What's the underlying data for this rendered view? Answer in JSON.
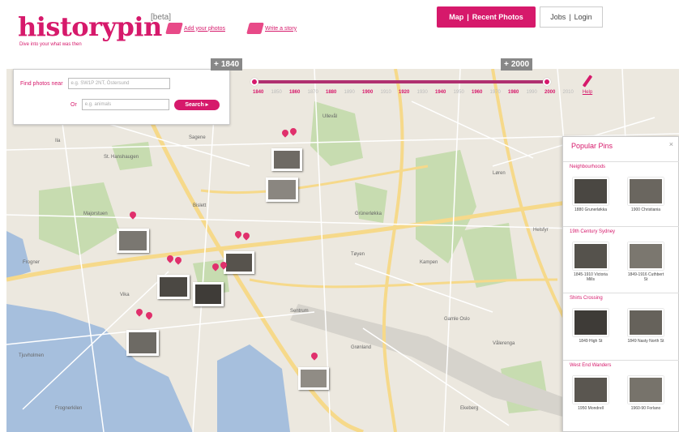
{
  "header": {
    "logo": "historypin",
    "beta": "[beta]",
    "tagline": "Dive into your what was then",
    "links": [
      "Add your photos",
      "Write a story"
    ],
    "nav_pink": [
      "Map",
      "|",
      "Recent Photos"
    ],
    "nav_white": [
      "Jobs",
      "|",
      "Login"
    ]
  },
  "search": {
    "label_find": "Find photos near",
    "placeholder_place": "e.g. SW1P 2NT, Östersund",
    "label_or": "Or",
    "placeholder_keyword": "e.g. animals",
    "button": "Search ▸"
  },
  "timeline": {
    "start_year": "1840",
    "end_year": "2000",
    "years": [
      "1840",
      "1850",
      "1860",
      "1870",
      "1880",
      "1890",
      "1900",
      "1910",
      "1920",
      "1930",
      "1940",
      "1950",
      "1960",
      "1970",
      "1980",
      "1990",
      "2000",
      "2010"
    ],
    "major_years": [
      "1840",
      "1860",
      "1880",
      "1900",
      "1920",
      "1940",
      "1960",
      "1980",
      "2000"
    ],
    "side_link": "Help"
  },
  "popular": {
    "title": "Popular Pins",
    "close": "×",
    "sections": [
      {
        "title": "Neighbourhoods",
        "items": [
          "1880 Grunerløkka",
          "1900 Christiania"
        ]
      },
      {
        "title": "19th Century Sydney",
        "items": [
          "1845-1910 Victoria Mills",
          "1849-1916 Cuthbert St"
        ]
      },
      {
        "title": "Shirts Crossing",
        "items": [
          "1849 High St",
          "1849 Nasty North St"
        ]
      },
      {
        "title": "West End Wanders",
        "items": [
          "1950 Mondrell",
          "1960-90 Forlano"
        ]
      }
    ]
  },
  "map_labels": [
    "Ila",
    "Sagene",
    "Grünerløkka",
    "Tøyen",
    "Sentrum",
    "Vika",
    "Frogner",
    "Majorstuen",
    "Gamle Oslo",
    "Vålerenga",
    "Kampen",
    "Grønland",
    "Tjuvholmen",
    "Bislett",
    "St. Hanshaugen",
    "Ullevål",
    "Frognerkilen",
    "Løren",
    "Helsfyr",
    "Ekeberg"
  ],
  "colors": {
    "brand": "#d6196b",
    "map_bg": "#ece8df",
    "park": "#c7dcb0",
    "water": "#a6bfdd",
    "road_major": "#f6d98a"
  }
}
